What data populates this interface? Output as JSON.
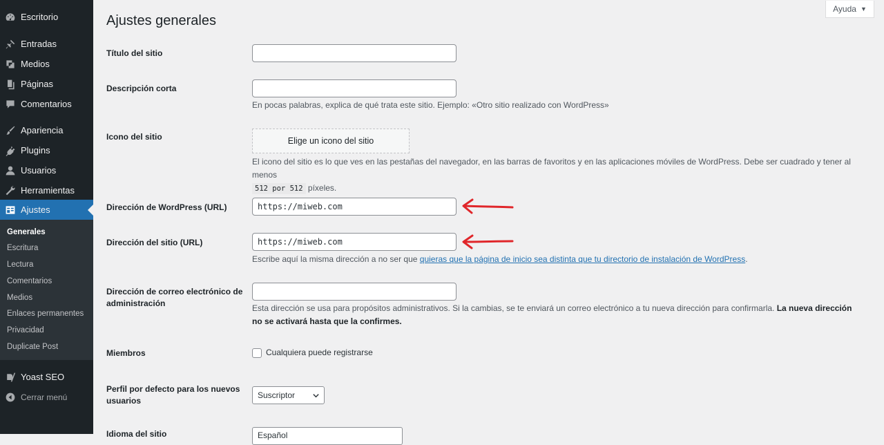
{
  "sidebar": {
    "menu": [
      {
        "label": "Escritorio",
        "icon": "dashboard-icon"
      },
      {
        "label": "Entradas",
        "icon": "pin-icon"
      },
      {
        "label": "Medios",
        "icon": "media-icon"
      },
      {
        "label": "Páginas",
        "icon": "page-icon"
      },
      {
        "label": "Comentarios",
        "icon": "comment-icon"
      },
      {
        "label": "Apariencia",
        "icon": "brush-icon"
      },
      {
        "label": "Plugins",
        "icon": "plugin-icon"
      },
      {
        "label": "Usuarios",
        "icon": "user-icon"
      },
      {
        "label": "Herramientas",
        "icon": "wrench-icon"
      },
      {
        "label": "Ajustes",
        "icon": "settings-icon",
        "active": true
      }
    ],
    "submenu": [
      "Generales",
      "Escritura",
      "Lectura",
      "Comentarios",
      "Medios",
      "Enlaces permanentes",
      "Privacidad",
      "Duplicate Post"
    ],
    "yoast": {
      "label": "Yoast SEO",
      "icon": "yoast-icon"
    },
    "collapse": {
      "label": "Cerrar menú",
      "icon": "collapse-icon"
    }
  },
  "help": {
    "label": "Ayuda",
    "arrow": "▼"
  },
  "page": {
    "title": "Ajustes generales"
  },
  "fields": {
    "site_title": {
      "label": "Título del sitio",
      "value": ""
    },
    "tagline": {
      "label": "Descripción corta",
      "value": "",
      "description": "En pocas palabras, explica de qué trata este sitio. Ejemplo: «Otro sitio realizado con WordPress»"
    },
    "site_icon": {
      "label": "Icono del sitio",
      "button": "Elige un icono del sitio",
      "description": "El icono del sitio es lo que ves en las pestañas del navegador, en las barras de favoritos y en las aplicaciones móviles de WordPress. Debe ser cuadrado y tener al menos",
      "code": "512 por 512",
      "description_end": "píxeles."
    },
    "wp_url": {
      "label": "Dirección de WordPress (URL)",
      "value": "https://miweb.com"
    },
    "site_url": {
      "label": "Dirección del sitio (URL)",
      "value": "https://miweb.com",
      "description_pre": "Escribe aquí la misma dirección a no ser que",
      "link": "quieras que la página de inicio sea distinta que tu directorio de instalación de WordPress",
      "description_post": "."
    },
    "admin_email": {
      "label": "Dirección de correo electrónico de administración",
      "value": "",
      "description": "Esta dirección se usa para propósitos administrativos. Si la cambias, se te enviará un correo electrónico a tu nueva dirección para confirmarla.",
      "description_bold": "La nueva dirección no se activará hasta que la confirmes."
    },
    "members": {
      "label": "Miembros",
      "checkbox_label": "Cualquiera puede registrarse",
      "checked": false
    },
    "default_role": {
      "label": "Perfil por defecto para los nuevos usuarios",
      "value": "Suscriptor"
    },
    "language": {
      "label": "Idioma del sitio",
      "value": "Español"
    }
  },
  "colors": {
    "sidebar": "#1d2327",
    "submenu": "#2c3338",
    "accent": "#2271b1",
    "annotation": "#e0262a"
  }
}
